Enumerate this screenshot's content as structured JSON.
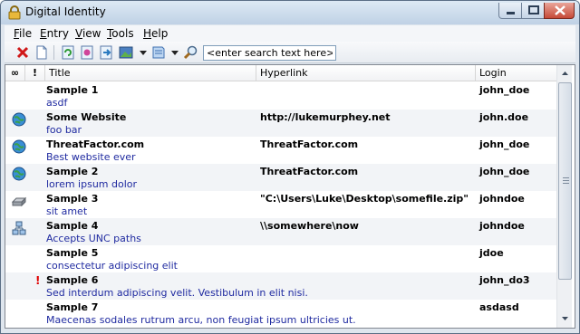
{
  "window": {
    "title": "Digital Identity"
  },
  "menu": [
    {
      "ul": "F",
      "rest": "ile"
    },
    {
      "ul": "E",
      "rest": "ntry"
    },
    {
      "ul": "V",
      "rest": "iew"
    },
    {
      "ul": "T",
      "rest": "ools"
    },
    {
      "ul": "H",
      "rest": "elp"
    }
  ],
  "search": {
    "value": "<enter search text here>"
  },
  "columns": {
    "icon": "∞",
    "flag": "!",
    "title": "Title",
    "hyperlink": "Hyperlink",
    "login": "Login"
  },
  "entries": [
    {
      "title": "Sample 1",
      "hyperlink": "",
      "login": "john_doe",
      "description": "asdf",
      "icon": "none",
      "flag": ""
    },
    {
      "title": "Some Website",
      "hyperlink": "http://lukemurphey.net",
      "login": "john.doe",
      "description": "foo bar",
      "icon": "globe-icon",
      "flag": ""
    },
    {
      "title": "ThreatFactor.com",
      "hyperlink": "ThreatFactor.com",
      "login": "john_doe",
      "description": "Best website ever",
      "icon": "globe-icon",
      "flag": ""
    },
    {
      "title": "Sample 2",
      "hyperlink": "ThreatFactor.com",
      "login": "john_doe",
      "description": "lorem ipsum dolor",
      "icon": "globe-icon",
      "flag": ""
    },
    {
      "title": "Sample 3",
      "hyperlink": "\"C:\\Users\\Luke\\Desktop\\somefile.zip\"",
      "login": "johndoe",
      "description": "sit amet",
      "icon": "drive-icon",
      "flag": ""
    },
    {
      "title": "Sample 4",
      "hyperlink": "\\\\somewhere\\now",
      "login": "johndoe",
      "description": "Accepts UNC paths",
      "icon": "network-icon",
      "flag": ""
    },
    {
      "title": "Sample 5",
      "hyperlink": "",
      "login": "jdoe",
      "description": "consectetur adipiscing elit",
      "icon": "none",
      "flag": ""
    },
    {
      "title": "Sample 6",
      "hyperlink": "",
      "login": "john_do3",
      "description": "Sed interdum adipiscing velit. Vestibulum in elit nisi.",
      "icon": "none",
      "flag": "!"
    },
    {
      "title": "Sample 7",
      "hyperlink": "",
      "login": "asdasd",
      "description": "Maecenas sodales rutrum arcu, non feugiat ipsum ultricies ut.",
      "icon": "none",
      "flag": ""
    }
  ],
  "colors": {
    "description": "#1f2aa0",
    "flag": "#e00000",
    "alt_row": "#f2f4f7"
  }
}
